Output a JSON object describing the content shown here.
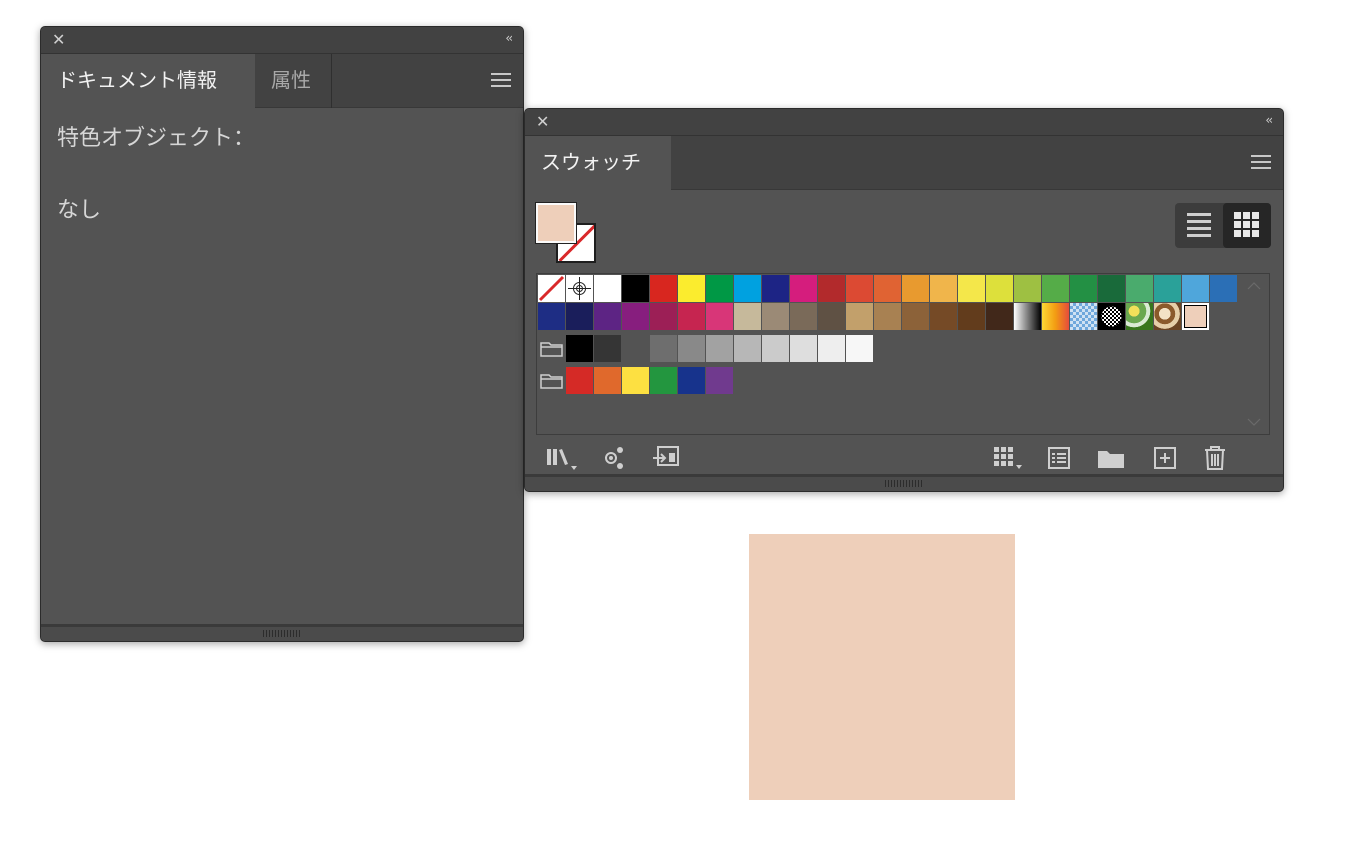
{
  "doc_info_panel": {
    "tabs": [
      {
        "label": "ドキュメント情報",
        "active": true
      },
      {
        "label": "属性",
        "active": false
      }
    ],
    "heading": "特色オブジェクト：",
    "value": "なし"
  },
  "swatches_panel": {
    "tab_label": "スウォッチ",
    "fill_color": "#eecfba",
    "row1": [
      "none",
      "registration",
      "#ffffff",
      "#000000",
      "#d8261f",
      "#fbec2e",
      "#009845",
      "#00a1e0",
      "#1d2485",
      "#d51d7d",
      "#b22a2c",
      "#dc4a33",
      "#e06333",
      "#e89a2f",
      "#f0b54b",
      "#f4e74a",
      "#dde03b",
      "#9ec042",
      "#55ac48",
      "#239044",
      "#196a3a",
      "#4aab6d",
      "#2aa199",
      "#4fa6db",
      "#2b6fb6"
    ],
    "row2": [
      "#1e2d84",
      "#1a1e5b",
      "#5d2484",
      "#871e7e",
      "#9c1f56",
      "#c62550",
      "#d83678",
      "#c6b99b",
      "#9b8a76",
      "#7a6a59",
      "#5f5144",
      "#c2a06b",
      "#a88152",
      "#8c6239",
      "#754a26",
      "#623c1c",
      "#41281a",
      "gradient-bw",
      "gradient-yellow",
      "pattern-blue",
      "pattern-circle",
      "pattern-green",
      "pattern-brown",
      "#eecfba"
    ],
    "gray_group": [
      "#000000",
      "#353535",
      "#535353",
      "#6e6e6e",
      "#898989",
      "#a2a2a2",
      "#b7b7b7",
      "#cbcbcb",
      "#dedede",
      "#eeeeee",
      "#f7f7f7"
    ],
    "color_group": [
      "#d52a26",
      "#e0692c",
      "#fde041",
      "#23963f",
      "#17338c",
      "#703a8e"
    ]
  },
  "artwork": {
    "fill": "#eecfba"
  }
}
